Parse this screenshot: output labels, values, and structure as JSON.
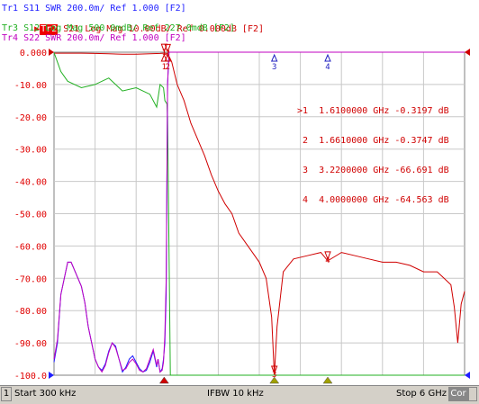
{
  "traces": [
    {
      "label": "Tr1 S11 SWR 200.0m/ Ref 1.000 [F2]",
      "color": "#2020ff",
      "selected": false
    },
    {
      "label": "S21 Log Mag 10.00dB/ Ref 0.000dB [F2]",
      "tag": "Tr2",
      "color": "#d00000",
      "selected": true
    },
    {
      "label": "Tr3 S12 Log Mag 500.0mdB/ Ref 227.0mdB [F2]",
      "color": "#22b022",
      "selected": false
    },
    {
      "label": "Tr4 S22 SWR 200.0m/ Ref 1.000 [F2]",
      "color": "#c000c0",
      "selected": false
    }
  ],
  "y_tick_labels": [
    "0.000",
    "-10.00",
    "-20.00",
    "-30.00",
    "-40.00",
    "-50.00",
    "-60.00",
    "-70.00",
    "-80.00",
    "-90.00",
    "-100.0"
  ],
  "marker_table": [
    {
      "prefix": ">1",
      "freq": "1.6100000 GHz",
      "value": "-0.3197 dB"
    },
    {
      "prefix": " 2",
      "freq": "1.6610000 GHz",
      "value": "-0.3747 dB"
    },
    {
      "prefix": " 3",
      "freq": "3.2200000 GHz",
      "value": "-66.691 dB"
    },
    {
      "prefix": " 4",
      "freq": "4.0000000 GHz",
      "value": "-64.563 dB"
    }
  ],
  "status": {
    "channel": "1",
    "start": "Start 300 kHz",
    "ifbw": "IFBW 10 kHz",
    "stop": "Stop 6 GHz",
    "cor": "Cor"
  },
  "chart_data": {
    "type": "line",
    "xlabel": "",
    "ylabel": "",
    "xlim_ghz": [
      0.0003,
      6
    ],
    "ylim": [
      -100,
      0
    ],
    "y_divisions": 10,
    "grid": true,
    "series": [
      {
        "name": "S21",
        "x": [
          0.0003,
          0.2,
          0.4,
          0.6,
          0.8,
          1.0,
          1.2,
          1.4,
          1.55,
          1.61,
          1.661,
          1.72,
          1.8,
          1.9,
          2.0,
          2.1,
          2.2,
          2.3,
          2.4,
          2.5,
          2.6,
          2.7,
          2.8,
          2.9,
          3.0,
          3.1,
          3.18,
          3.22,
          3.26,
          3.35,
          3.5,
          3.7,
          3.9,
          4.0,
          4.2,
          4.4,
          4.6,
          4.8,
          5.0,
          5.2,
          5.4,
          5.6,
          5.7,
          5.8,
          5.85,
          5.9,
          5.95,
          6.0
        ],
        "y": [
          -0.3,
          -0.3,
          -0.3,
          -0.4,
          -0.5,
          -0.6,
          -0.6,
          -0.5,
          -0.4,
          -0.32,
          -0.37,
          -3,
          -10,
          -15,
          -22,
          -27,
          -32,
          -38,
          -43,
          -47,
          -50,
          -56,
          -59,
          -62,
          -65,
          -70,
          -82,
          -100,
          -85,
          -68,
          -64,
          -63,
          -62,
          -64.6,
          -62,
          -63,
          -64,
          -65,
          -65,
          -66,
          -68,
          -68,
          -70,
          -72,
          -79,
          -90,
          -78,
          -74
        ]
      },
      {
        "name": "S12",
        "x": [
          0.0003,
          0.1,
          0.2,
          0.4,
          0.6,
          0.8,
          1.0,
          1.2,
          1.4,
          1.5,
          1.55,
          1.6,
          1.62,
          1.65,
          1.66,
          1.67,
          1.7,
          1.8,
          2.5,
          3.5,
          4.5,
          6.0
        ],
        "y": [
          -0.1,
          -6,
          -9,
          -11,
          -10,
          -8,
          -12,
          -11,
          -13,
          -17,
          -10,
          -11,
          -15,
          -16,
          -20,
          -40,
          -100,
          -100,
          -100,
          -100,
          -100,
          -100
        ]
      },
      {
        "name": "S11",
        "x": [
          0.0003,
          0.05,
          0.1,
          0.15,
          0.2,
          0.25,
          0.3,
          0.35,
          0.4,
          0.45,
          0.5,
          0.55,
          0.6,
          0.65,
          0.7,
          0.75,
          0.8,
          0.85,
          0.9,
          0.95,
          1.0,
          1.05,
          1.1,
          1.15,
          1.2,
          1.25,
          1.3,
          1.35,
          1.4,
          1.45,
          1.5,
          1.52,
          1.55,
          1.58,
          1.6,
          1.62,
          1.64,
          1.66,
          1.68,
          1.7,
          1.72,
          1.8,
          2.0,
          3.0,
          4.0,
          6.0
        ],
        "y": [
          1.08,
          1.2,
          1.5,
          1.6,
          1.7,
          1.7,
          1.65,
          1.6,
          1.55,
          1.45,
          1.3,
          1.2,
          1.1,
          1.05,
          1.03,
          1.07,
          1.15,
          1.2,
          1.18,
          1.1,
          1.02,
          1.05,
          1.1,
          1.12,
          1.08,
          1.04,
          1.02,
          1.03,
          1.08,
          1.15,
          1.05,
          1.1,
          1.02,
          1.04,
          1.1,
          1.2,
          1.5,
          2.8,
          3.0,
          3.0,
          3.0,
          3.0,
          3.0,
          3.0,
          3.0,
          3.0
        ]
      },
      {
        "name": "S22",
        "x": [
          0.0003,
          0.05,
          0.1,
          0.15,
          0.2,
          0.25,
          0.3,
          0.35,
          0.4,
          0.45,
          0.5,
          0.55,
          0.6,
          0.65,
          0.7,
          0.75,
          0.8,
          0.85,
          0.9,
          0.95,
          1.0,
          1.05,
          1.1,
          1.15,
          1.2,
          1.25,
          1.3,
          1.35,
          1.4,
          1.45,
          1.5,
          1.52,
          1.55,
          1.58,
          1.6,
          1.62,
          1.64,
          1.66,
          1.68,
          1.7,
          1.72,
          1.8,
          2.0,
          3.0,
          4.0,
          6.0
        ],
        "y": [
          1.1,
          1.22,
          1.5,
          1.6,
          1.7,
          1.7,
          1.65,
          1.6,
          1.55,
          1.45,
          1.3,
          1.2,
          1.1,
          1.05,
          1.02,
          1.06,
          1.14,
          1.2,
          1.17,
          1.1,
          1.03,
          1.04,
          1.08,
          1.1,
          1.07,
          1.03,
          1.02,
          1.04,
          1.1,
          1.16,
          1.06,
          1.1,
          1.02,
          1.03,
          1.08,
          1.25,
          1.6,
          2.8,
          3.0,
          3.0,
          3.0,
          3.0,
          3.0,
          3.0,
          3.0,
          3.0
        ]
      }
    ],
    "markers": [
      {
        "label": "1",
        "x": 1.61,
        "trace": "S21"
      },
      {
        "label": "2",
        "x": 1.661,
        "trace": "S21"
      },
      {
        "label": "3",
        "x": 3.22,
        "trace": "S21"
      },
      {
        "label": "4",
        "x": 4.0,
        "trace": "S21"
      }
    ]
  },
  "colors": {
    "grid": "#c8c8c8",
    "axis_text": "#e00000",
    "s21": "#d00000",
    "s12": "#22b022",
    "s11": "#2020ff",
    "s22": "#c000c0",
    "ref_line": "#0000cc"
  }
}
